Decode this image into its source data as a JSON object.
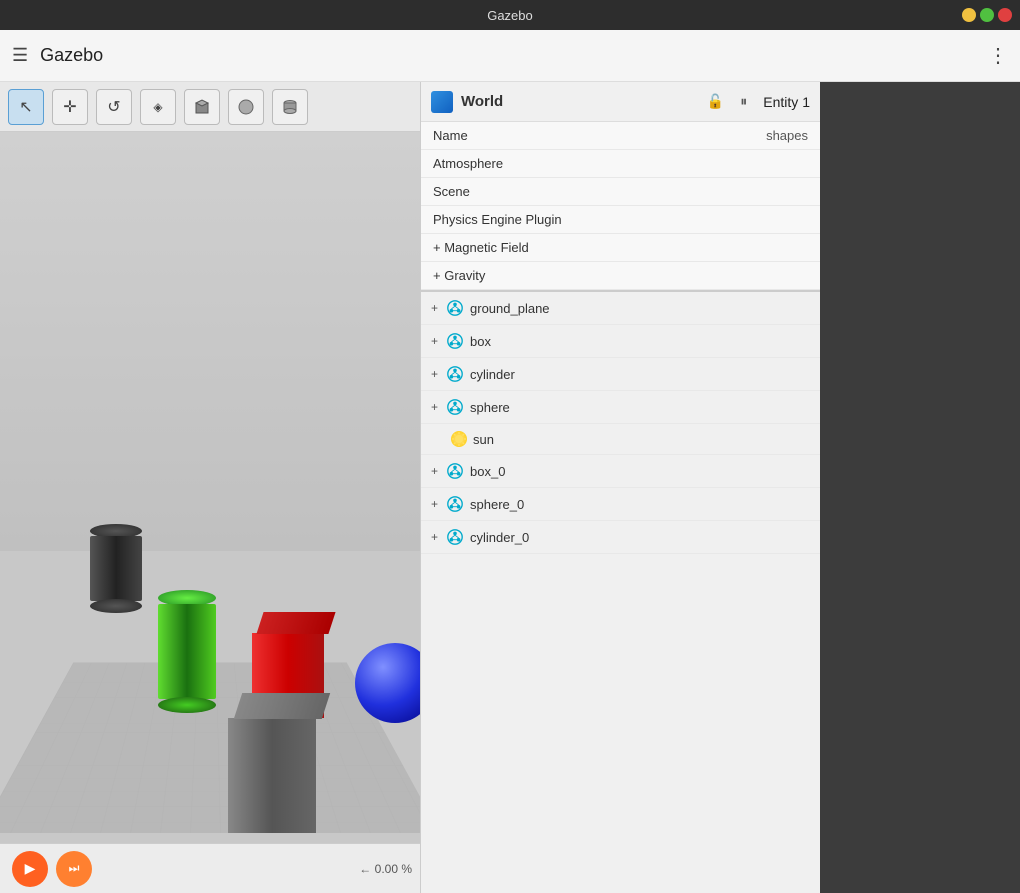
{
  "titlebar": {
    "title": "Gazebo"
  },
  "menubar": {
    "title": "Gazebo",
    "hamburger_label": "☰",
    "dots_label": "⋮"
  },
  "toolbar": {
    "buttons": [
      {
        "id": "select",
        "icon": "↖",
        "active": true,
        "label": "Select"
      },
      {
        "id": "move",
        "icon": "✛",
        "active": false,
        "label": "Move"
      },
      {
        "id": "rotate",
        "icon": "↺",
        "active": false,
        "label": "Rotate"
      },
      {
        "id": "shape3d",
        "icon": "◈",
        "active": false,
        "label": "Shape3D"
      },
      {
        "id": "box",
        "icon": "▣",
        "active": false,
        "label": "Box"
      },
      {
        "id": "sphere",
        "icon": "○",
        "active": false,
        "label": "Sphere"
      },
      {
        "id": "cylinder",
        "icon": "⬛",
        "active": false,
        "label": "Cylinder"
      }
    ]
  },
  "viewport": {
    "zoom_text": "0.00 %",
    "play_label": "▶",
    "fast_forward_label": "⏭"
  },
  "world_panel": {
    "title": "World",
    "entity_label": "Entity 1",
    "lock_icon": "🔓",
    "pause_icon": "⏸",
    "properties": [
      {
        "name": "Name",
        "value": "shapes",
        "expandable": false,
        "plus": false
      },
      {
        "name": "Atmosphere",
        "value": "",
        "expandable": false,
        "plus": false
      },
      {
        "name": "Scene",
        "value": "",
        "expandable": false,
        "plus": false
      },
      {
        "name": "Physics Engine Plugin",
        "value": "",
        "expandable": false,
        "plus": false
      },
      {
        "name": "Magnetic Field",
        "value": "",
        "expandable": false,
        "plus": true
      },
      {
        "name": "Gravity",
        "value": "",
        "expandable": false,
        "plus": true
      }
    ],
    "entities": [
      {
        "id": "ground_plane",
        "label": "ground_plane",
        "type": "model",
        "indent": false,
        "plus": true
      },
      {
        "id": "box",
        "label": "box",
        "type": "model",
        "indent": false,
        "plus": true
      },
      {
        "id": "cylinder",
        "label": "cylinder",
        "type": "model",
        "indent": false,
        "plus": true
      },
      {
        "id": "sphere",
        "label": "sphere",
        "type": "model",
        "indent": false,
        "plus": true
      },
      {
        "id": "sun",
        "label": "sun",
        "type": "light",
        "indent": true,
        "plus": false
      },
      {
        "id": "box_0",
        "label": "box_0",
        "type": "model",
        "indent": false,
        "plus": true
      },
      {
        "id": "sphere_0",
        "label": "sphere_0",
        "type": "model",
        "indent": false,
        "plus": true
      },
      {
        "id": "cylinder_0",
        "label": "cylinder_0",
        "type": "model",
        "indent": false,
        "plus": true
      }
    ]
  }
}
